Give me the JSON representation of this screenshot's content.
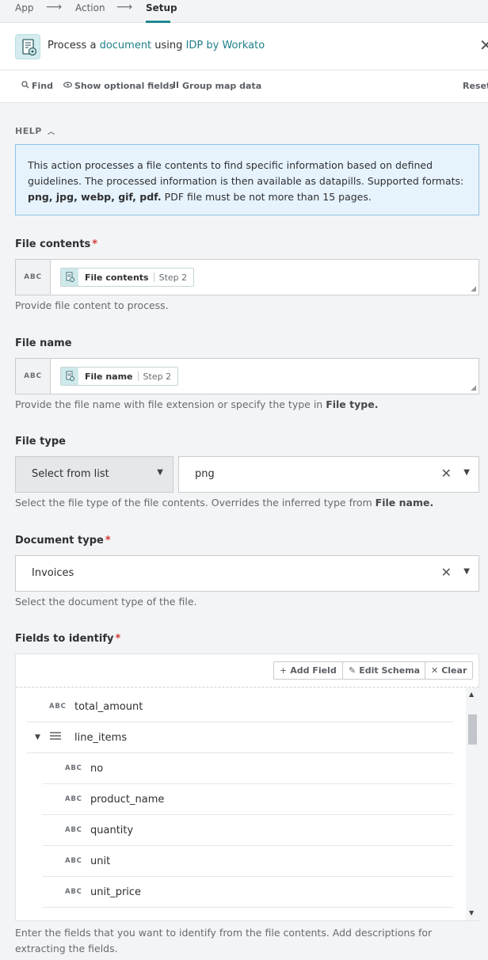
{
  "breadcrumbs": [
    {
      "label": "App"
    },
    {
      "label": "Action"
    },
    {
      "label": "Setup"
    }
  ],
  "header": {
    "prefix": "Process a",
    "object": "document",
    "middle": "using",
    "app": "IDP by Workato",
    "close_glyph": "✕"
  },
  "toolbar": {
    "find": "Find",
    "optional": "Show optional fields",
    "group": "Group map data",
    "reset": "Reset"
  },
  "help": {
    "toggle": "HELP",
    "text_1": "This action processes a file contents to find specific information based on defined guidelines. The processed information is then available as datapills. Supported formats:",
    "formats": "png, jpg, webp, gif, pdf.",
    "text_2": "PDF file must be not more than 15 pages."
  },
  "fields": {
    "file_contents": {
      "label": "File contents",
      "type_tag": "ABC",
      "pill_name": "File contents",
      "pill_step": "Step 2",
      "hint": "Provide file content to process."
    },
    "file_name": {
      "label": "File name",
      "type_tag": "ABC",
      "pill_name": "File name",
      "pill_step": "Step 2",
      "hint_prefix": "Provide the file name with file extension or specify the type in",
      "hint_bold": "File type."
    },
    "file_type": {
      "label": "File type",
      "mode": "Select from list",
      "value": "png",
      "hint_prefix": "Select the file type of the file contents. Overrides the inferred type from",
      "hint_bold": "File name."
    },
    "document_type": {
      "label": "Document type",
      "value": "Invoices",
      "hint": "Select the document type of the file."
    },
    "fields_to_identify": {
      "label": "Fields to identify",
      "buttons": {
        "add": "Add Field",
        "edit": "Edit Schema",
        "clear": "Clear"
      },
      "rows": [
        {
          "type": "ABC",
          "name": "total_amount"
        },
        {
          "type": "list",
          "name": "line_items"
        },
        {
          "type": "ABC",
          "name": "no"
        },
        {
          "type": "ABC",
          "name": "product_name"
        },
        {
          "type": "ABC",
          "name": "quantity"
        },
        {
          "type": "ABC",
          "name": "unit"
        },
        {
          "type": "ABC",
          "name": "unit_price"
        }
      ],
      "hint": "Enter the fields that you want to identify from the file contents. Add descriptions for extracting the fields."
    }
  },
  "colors": {
    "accent": "#1e8891",
    "required": "#d23a3a",
    "help_bg": "#e6f3fc",
    "help_border": "#8fc3e8"
  }
}
